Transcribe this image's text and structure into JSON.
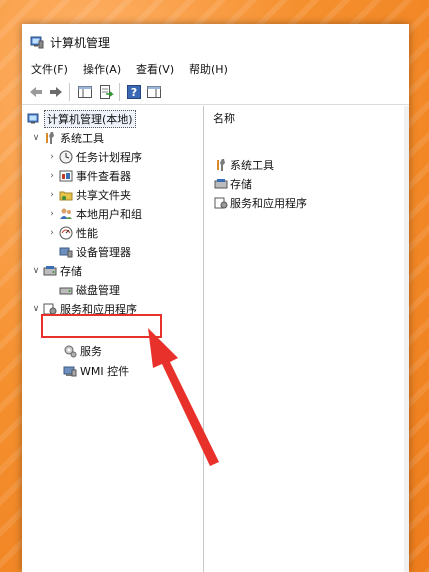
{
  "window": {
    "title": "计算机管理"
  },
  "menu": [
    "文件(F)",
    "操作(A)",
    "查看(V)",
    "帮助(H)"
  ],
  "toolbar": [
    "back-icon",
    "forward-icon",
    "show-hide-tree-icon",
    "export-list-icon",
    "help-icon",
    "properties-icon"
  ],
  "tree": {
    "root": "计算机管理(本地)",
    "system_tools": {
      "label": "系统工具",
      "children": [
        "任务计划程序",
        "事件查看器",
        "共享文件夹",
        "本地用户和组",
        "性能",
        "设备管理器"
      ]
    },
    "storage": {
      "label": "存储",
      "children": [
        "磁盘管理"
      ]
    },
    "services_apps": {
      "label": "服务和应用程序",
      "children": [
        "服务",
        "WMI 控件"
      ]
    }
  },
  "list": {
    "header": "名称",
    "items": [
      "系统工具",
      "存储",
      "服务和应用程序"
    ]
  },
  "colors": {
    "annotation": "#e8312a",
    "background": "#f5902f"
  }
}
